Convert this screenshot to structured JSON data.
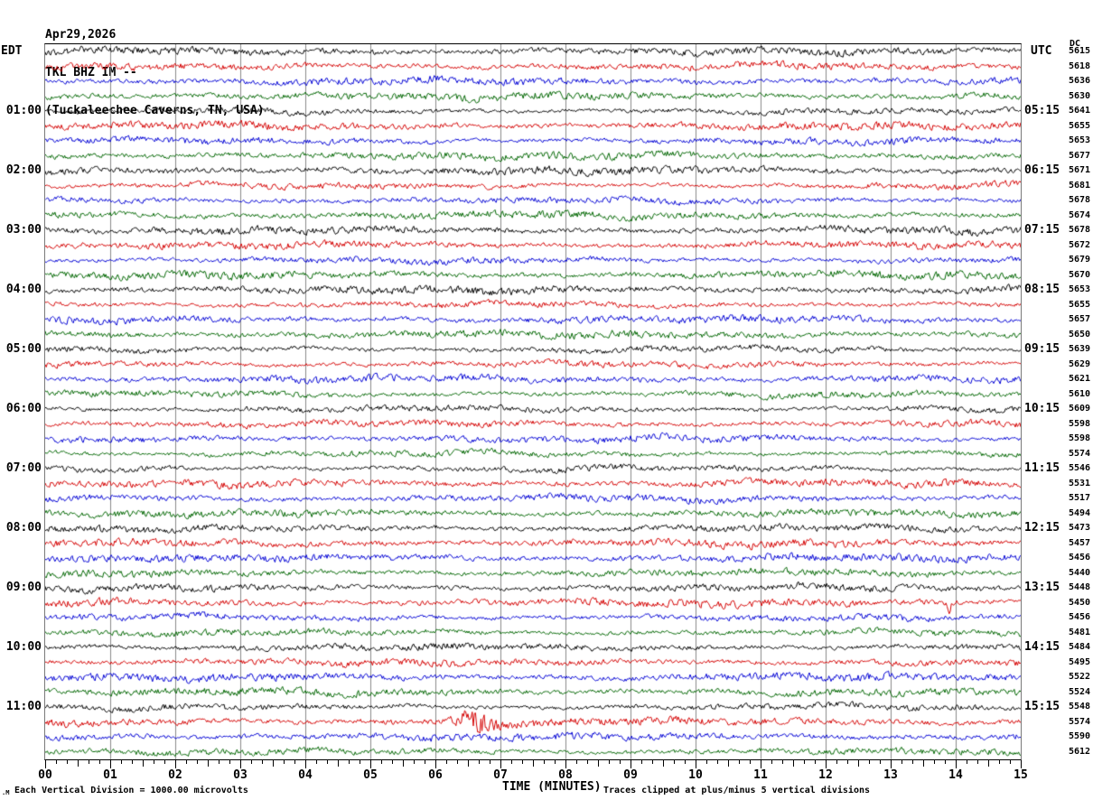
{
  "title": {
    "date": "Apr29,2026",
    "station": "TKL BHZ IM --",
    "location": "(Tuckaleechee Caverns, TN, USA)"
  },
  "headers": {
    "left": "EDT",
    "right": "UTC",
    "dc": "DC"
  },
  "x_axis": {
    "label": "TIME (MINUTES)",
    "ticks": [
      "00",
      "01",
      "02",
      "03",
      "04",
      "05",
      "06",
      "07",
      "08",
      "09",
      "10",
      "11",
      "12",
      "13",
      "14",
      "15"
    ]
  },
  "footer": {
    "corner_mark": ".M",
    "scale_note": "Each Vertical Division = 1000.00 microvolts",
    "clip_note": "Traces clipped at plus/minus 5 vertical divisions"
  },
  "palette": {
    "black": "#000000",
    "red": "#d40000",
    "blue": "#0000d4",
    "green": "#006600",
    "grid": "#8a8a8a",
    "axis": "#000000"
  },
  "chart_data": {
    "type": "line",
    "subtype": "seismogram-helicorder",
    "station_line": "TKL BHZ IM --",
    "location_name": "Tuckaleechee Caverns, TN, USA",
    "date": "Apr29,2026",
    "minutes_per_row": 15,
    "x_range": [
      0,
      15
    ],
    "rows_per_hour": 4,
    "color_cycle": [
      "black",
      "red",
      "blue",
      "green"
    ],
    "vertical_division": "1000.00 microvolts",
    "clip_limit": "plus/minus 5 vertical divisions",
    "rows": [
      {
        "edt": "",
        "utc": "",
        "dc": "5615",
        "color": "black"
      },
      {
        "edt": "",
        "utc": "",
        "dc": "5618",
        "color": "red"
      },
      {
        "edt": "",
        "utc": "",
        "dc": "5636",
        "color": "blue"
      },
      {
        "edt": "",
        "utc": "",
        "dc": "5630",
        "color": "green"
      },
      {
        "edt": "01:00",
        "utc": "05:15",
        "dc": "5641",
        "color": "black"
      },
      {
        "edt": "",
        "utc": "",
        "dc": "5655",
        "color": "red"
      },
      {
        "edt": "",
        "utc": "",
        "dc": "5653",
        "color": "blue"
      },
      {
        "edt": "",
        "utc": "",
        "dc": "5677",
        "color": "green"
      },
      {
        "edt": "02:00",
        "utc": "06:15",
        "dc": "5671",
        "color": "black"
      },
      {
        "edt": "",
        "utc": "",
        "dc": "5681",
        "color": "red"
      },
      {
        "edt": "",
        "utc": "",
        "dc": "5678",
        "color": "blue"
      },
      {
        "edt": "",
        "utc": "",
        "dc": "5674",
        "color": "green"
      },
      {
        "edt": "03:00",
        "utc": "07:15",
        "dc": "5678",
        "color": "black"
      },
      {
        "edt": "",
        "utc": "",
        "dc": "5672",
        "color": "red"
      },
      {
        "edt": "",
        "utc": "",
        "dc": "5679",
        "color": "blue"
      },
      {
        "edt": "",
        "utc": "",
        "dc": "5670",
        "color": "green"
      },
      {
        "edt": "04:00",
        "utc": "08:15",
        "dc": "5653",
        "color": "black"
      },
      {
        "edt": "",
        "utc": "",
        "dc": "5655",
        "color": "red"
      },
      {
        "edt": "",
        "utc": "",
        "dc": "5657",
        "color": "blue"
      },
      {
        "edt": "",
        "utc": "",
        "dc": "5650",
        "color": "green"
      },
      {
        "edt": "05:00",
        "utc": "09:15",
        "dc": "5639",
        "color": "black"
      },
      {
        "edt": "",
        "utc": "",
        "dc": "5629",
        "color": "red"
      },
      {
        "edt": "",
        "utc": "",
        "dc": "5621",
        "color": "blue"
      },
      {
        "edt": "",
        "utc": "",
        "dc": "5610",
        "color": "green"
      },
      {
        "edt": "06:00",
        "utc": "10:15",
        "dc": "5609",
        "color": "black"
      },
      {
        "edt": "",
        "utc": "",
        "dc": "5598",
        "color": "red"
      },
      {
        "edt": "",
        "utc": "",
        "dc": "5598",
        "color": "blue"
      },
      {
        "edt": "",
        "utc": "",
        "dc": "5574",
        "color": "green"
      },
      {
        "edt": "07:00",
        "utc": "11:15",
        "dc": "5546",
        "color": "black"
      },
      {
        "edt": "",
        "utc": "",
        "dc": "5531",
        "color": "red"
      },
      {
        "edt": "",
        "utc": "",
        "dc": "5517",
        "color": "blue"
      },
      {
        "edt": "",
        "utc": "",
        "dc": "5494",
        "color": "green"
      },
      {
        "edt": "08:00",
        "utc": "12:15",
        "dc": "5473",
        "color": "black"
      },
      {
        "edt": "",
        "utc": "",
        "dc": "5457",
        "color": "red"
      },
      {
        "edt": "",
        "utc": "",
        "dc": "5456",
        "color": "blue"
      },
      {
        "edt": "",
        "utc": "",
        "dc": "5440",
        "color": "green"
      },
      {
        "edt": "09:00",
        "utc": "13:15",
        "dc": "5448",
        "color": "black"
      },
      {
        "edt": "",
        "utc": "",
        "dc": "5450",
        "color": "red"
      },
      {
        "edt": "",
        "utc": "",
        "dc": "5456",
        "color": "blue"
      },
      {
        "edt": "",
        "utc": "",
        "dc": "5481",
        "color": "green"
      },
      {
        "edt": "10:00",
        "utc": "14:15",
        "dc": "5484",
        "color": "black"
      },
      {
        "edt": "",
        "utc": "",
        "dc": "5495",
        "color": "red"
      },
      {
        "edt": "",
        "utc": "",
        "dc": "5522",
        "color": "blue"
      },
      {
        "edt": "",
        "utc": "",
        "dc": "5524",
        "color": "green"
      },
      {
        "edt": "11:00",
        "utc": "15:15",
        "dc": "5548",
        "color": "black"
      },
      {
        "edt": "",
        "utc": "",
        "dc": "5574",
        "color": "red"
      },
      {
        "edt": "",
        "utc": "",
        "dc": "5590",
        "color": "blue"
      },
      {
        "edt": "",
        "utc": "",
        "dc": "5612",
        "color": "green"
      }
    ],
    "events": [
      {
        "row_index": 45,
        "minute": 6.55,
        "kind": "burst",
        "note": "larger-amplitude wave packet on red trace after 11:00 EDT"
      },
      {
        "row_index": 37,
        "minute": 13.9,
        "kind": "spike",
        "note": "sharp single spike on red trace after 13:15 UTC"
      }
    ]
  }
}
